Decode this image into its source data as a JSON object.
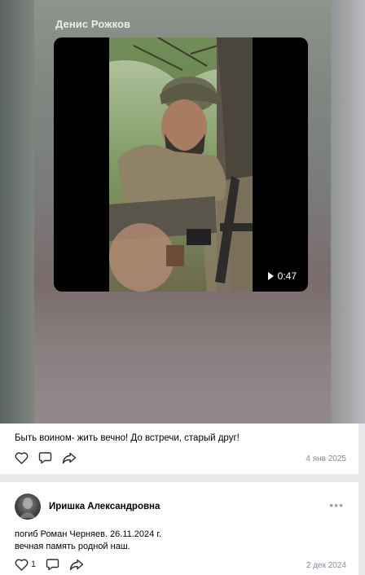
{
  "post": {
    "author": "Денис Рожков",
    "video_duration": "0:47",
    "caption": "Быть воином- жить вечно! До встречи, старый друг!",
    "date": "4 янв 2025"
  },
  "comment": {
    "author": "Иришка Александровна",
    "text_line_1": "погиб Роман Черняев. 26.11.2024 г.",
    "text_line_2": "вечная память родной наш.",
    "like_count": "1",
    "date": "2 дек 2024"
  },
  "icons": [
    "heart-icon",
    "comment-icon",
    "share-icon",
    "play-icon",
    "more-icon"
  ],
  "colors": {
    "date_text": "#818c99",
    "icon": "#2c2d2e",
    "more": "#99a2ad"
  }
}
